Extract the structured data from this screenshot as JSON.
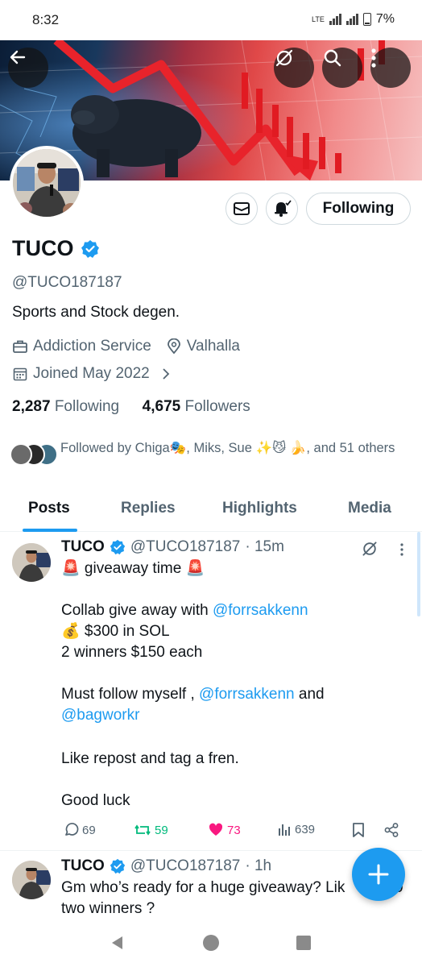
{
  "status_bar": {
    "time": "8:32",
    "network": "LTE",
    "battery": "7%"
  },
  "profile": {
    "name": "TUCO",
    "handle": "@TUCO187187",
    "bio": "Sports and Stock degen.",
    "category": "Addiction Service",
    "location": "Valhalla",
    "joined": "Joined May 2022",
    "following_count": "2,287",
    "following_label": "Following",
    "followers_count": "4,675",
    "followers_label": "Followers",
    "followed_by": "Followed by Chiga🎭, Miks, Sue ✨😼 🍌, and 51 others",
    "follow_button_label": "Following"
  },
  "tabs": [
    {
      "label": "Posts",
      "active": true
    },
    {
      "label": "Replies",
      "active": false
    },
    {
      "label": "Highlights",
      "active": false
    },
    {
      "label": "Media",
      "active": false
    }
  ],
  "posts": [
    {
      "author": "TUCO",
      "handle": "@TUCO187187",
      "time": "· 15m",
      "lines": {
        "l1": "🚨 giveaway time 🚨",
        "l2a": "Collab give away with ",
        "l2b": "@forrsakkenn",
        "l3": "💰 $300 in SOL",
        "l4": "2 winners $150 each",
        "l5a": "Must follow myself , ",
        "l5b": "@forrsakkenn",
        "l5c": " and",
        "l6": "@bagworkr",
        "l7": "Like repost and tag a fren.",
        "l8": "Good luck"
      },
      "replies": "69",
      "reposts": "59",
      "likes": "73",
      "views": "639"
    },
    {
      "author": "TUCO",
      "handle": "@TUCO187187",
      "time": "· 1h",
      "line1": "Gm who’s ready for a huge giveaway? Lik",
      "line1_tail": "0",
      "line2": "two winners ?"
    }
  ],
  "icons": {
    "back": "arrow-left-icon",
    "grok": "grok-icon",
    "search": "search-icon",
    "more": "more-vertical-icon",
    "message": "mail-icon",
    "notify": "bell-icon",
    "verified": "verified-badge-icon",
    "fab": "plus-icon"
  },
  "colors": {
    "accent": "#1d9bf0",
    "like": "#f91880",
    "repost": "#00ba7c",
    "text": "#0f1419",
    "muted": "#536471"
  }
}
